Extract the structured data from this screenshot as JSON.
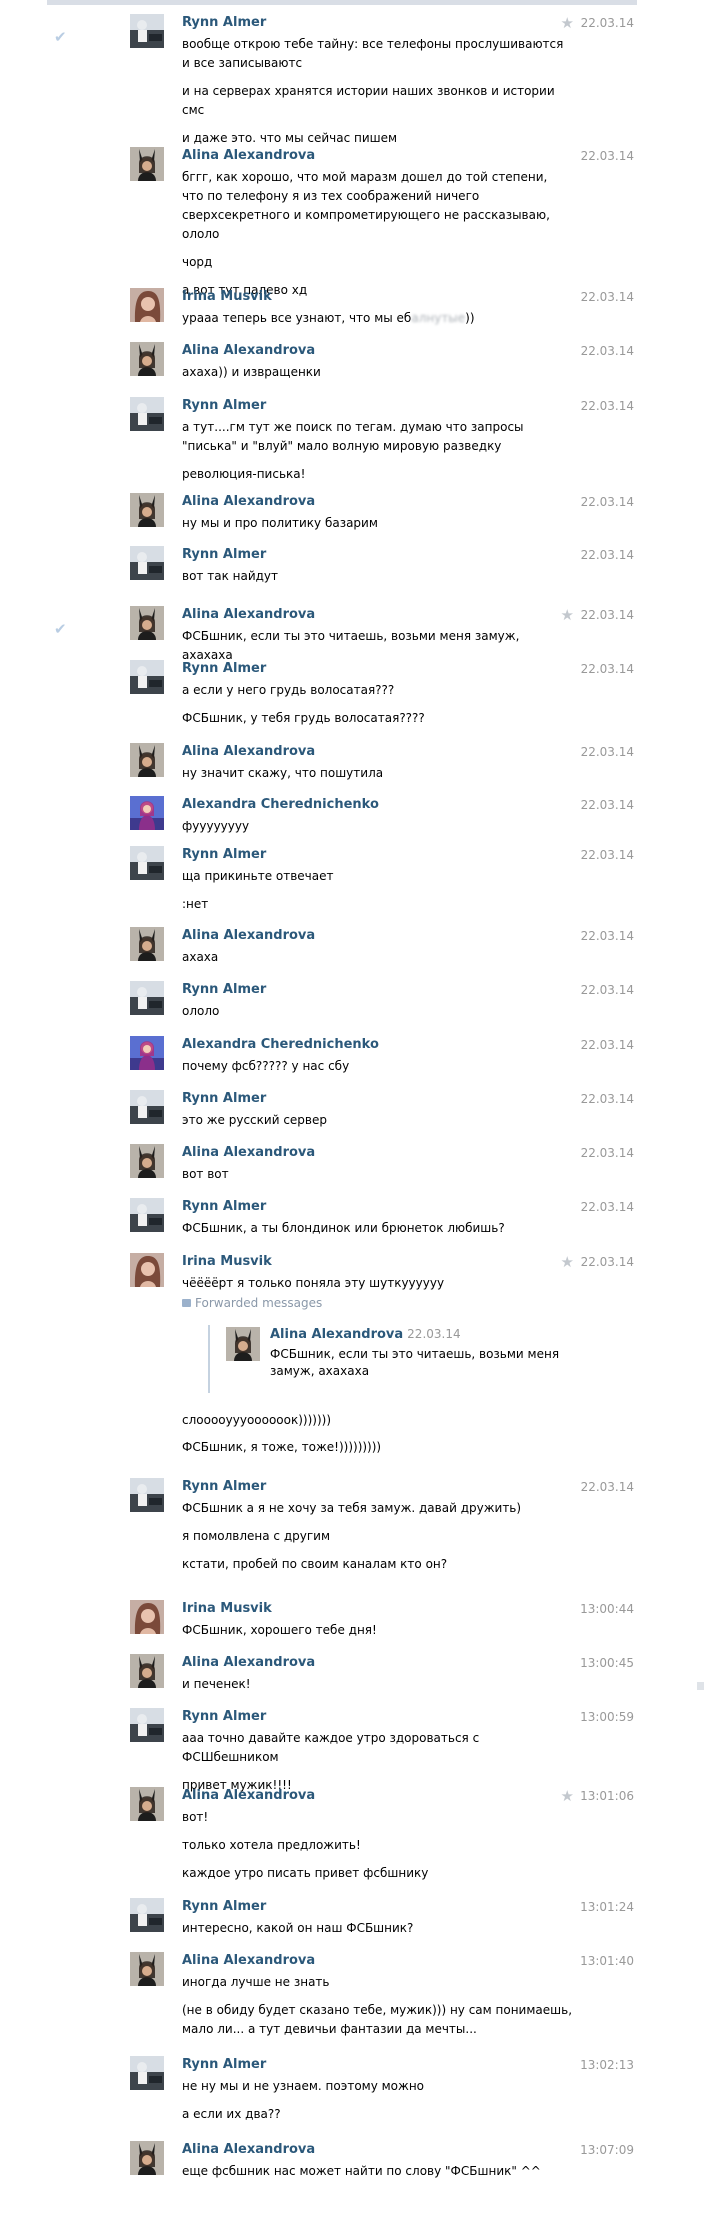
{
  "colors": {
    "name": "#2b587a",
    "time": "#999999",
    "text": "#000000"
  },
  "icons": {
    "star": "star-icon",
    "check": "checkmark-icon",
    "forward": "forwarded-icon"
  },
  "messages": [
    {
      "author": "Rynn Almer",
      "avatar": "rynn",
      "time": "22.03.14",
      "star": true,
      "check": true,
      "lines": [
        "вообще открою тебе тайну: все телефоны прослушиваются и все записываютс",
        "и на серверах хранятся истории наших звонков и истории смс",
        "и даже это. что мы сейчас пишем"
      ]
    },
    {
      "author": "Alina Alexandrova",
      "avatar": "alina",
      "time": "22.03.14",
      "lines": [
        "бггг, как хорошо, что мой маразм дошел до той степени, что по телефону я из тех соображений ничего сверхсекретного и компрометирующего не рассказываю, ололо",
        "чорд",
        "а вот тут палево хд"
      ]
    },
    {
      "author": "Irina Musvik",
      "avatar": "irina",
      "time": "22.03.14",
      "lines": [
        "урааа теперь все узнают, что мы еб",
        "))"
      ],
      "blur": "алнутые"
    },
    {
      "author": "Alina Alexandrova",
      "avatar": "alina",
      "time": "22.03.14",
      "lines": [
        "ахаха)) и извращенки"
      ]
    },
    {
      "author": "Rynn Almer",
      "avatar": "rynn",
      "time": "22.03.14",
      "lines": [
        "а тут....гм тут же поиск по тегам. думаю что запросы \"писька\" и \"влуй\" мало волную мировую разведку",
        "революция-писька!"
      ]
    },
    {
      "author": "Alina Alexandrova",
      "avatar": "alina",
      "time": "22.03.14",
      "lines": [
        "ну мы и про политику базарим"
      ]
    },
    {
      "author": "Rynn Almer",
      "avatar": "rynn",
      "time": "22.03.14",
      "lines": [
        "вот так найдут"
      ]
    },
    {
      "author": "Alina Alexandrova",
      "avatar": "alina",
      "time": "22.03.14",
      "star": true,
      "check": true,
      "lines": [
        "ФСБшник, если ты это читаешь, возьми меня замуж, ахахаха"
      ]
    },
    {
      "author": "Rynn Almer",
      "avatar": "rynn",
      "time": "22.03.14",
      "lines": [
        "а если у него грудь волосатая???",
        "ФСБшник, у тебя грудь волосатая????"
      ]
    },
    {
      "author": "Alina Alexandrova",
      "avatar": "alina",
      "time": "22.03.14",
      "lines": [
        "ну значит скажу, что пошутила"
      ]
    },
    {
      "author": "Alexandra Cherednichenko",
      "avatar": "alexandra",
      "time": "22.03.14",
      "lines": [
        "фуууууууу"
      ]
    },
    {
      "author": "Rynn Almer",
      "avatar": "rynn",
      "time": "22.03.14",
      "lines": [
        "ща прикиньте отвечает",
        ":нет"
      ]
    },
    {
      "author": "Alina Alexandrova",
      "avatar": "alina",
      "time": "22.03.14",
      "lines": [
        "ахаха"
      ]
    },
    {
      "author": "Rynn Almer",
      "avatar": "rynn",
      "time": "22.03.14",
      "lines": [
        "ололо"
      ]
    },
    {
      "author": "Alexandra Cherednichenko",
      "avatar": "alexandra",
      "time": "22.03.14",
      "lines": [
        "почему фсб????? у нас сбу"
      ]
    },
    {
      "author": "Rynn Almer",
      "avatar": "rynn",
      "time": "22.03.14",
      "lines": [
        "это же русский сервер"
      ]
    },
    {
      "author": "Alina Alexandrova",
      "avatar": "alina",
      "time": "22.03.14",
      "lines": [
        "вот вот"
      ]
    },
    {
      "author": "Rynn Almer",
      "avatar": "rynn",
      "time": "22.03.14",
      "lines": [
        "ФСБшник, а ты блондинок или брюнеток любишь?"
      ]
    },
    {
      "author": "Irina Musvik",
      "avatar": "irina",
      "time": "22.03.14",
      "star": true,
      "lines": [
        "чёёёёрт я только поняла эту шуткуууууу"
      ]
    },
    {
      "author": "Rynn Almer",
      "avatar": "rynn",
      "time": "22.03.14",
      "lines": [
        "ФСБшник а я не хочу за тебя замуж. давай дружить)",
        "я помолвлена с другим",
        "кстати, пробей по своим каналам кто он?"
      ]
    },
    {
      "author": "Irina Musvik",
      "avatar": "irina",
      "time": "13:00:44",
      "lines": [
        "ФСБшник, хорошего тебе дня!"
      ]
    },
    {
      "author": "Alina Alexandrova",
      "avatar": "alina",
      "time": "13:00:45",
      "lines": [
        "и печенек!"
      ]
    },
    {
      "author": "Rynn Almer",
      "avatar": "rynn",
      "time": "13:00:59",
      "lines": [
        "ааа точно давайте каждое утро здороваться с ФСШбешником",
        "привет мужик!!!!"
      ]
    },
    {
      "author": "Alina Alexandrova",
      "avatar": "alina",
      "time": "13:01:06",
      "star": true,
      "lines": [
        "вот!",
        "только хотела предложить!",
        "каждое утро писать привет фсбшнику"
      ]
    },
    {
      "author": "Rynn Almer",
      "avatar": "rynn",
      "time": "13:01:24",
      "lines": [
        "интересно, какой он наш ФСБшник?"
      ]
    },
    {
      "author": "Alina Alexandrova",
      "avatar": "alina",
      "time": "13:01:40",
      "lines": [
        "иногда лучше не знать",
        "(не в обиду будет сказано тебе, мужик))) ну сам понимаешь, мало ли... а тут девичьи фантазии да мечты..."
      ]
    },
    {
      "author": "Rynn Almer",
      "avatar": "rynn",
      "time": "13:02:13",
      "lines": [
        "не ну мы и не узнаем. поэтому можно",
        "а если их два??"
      ]
    },
    {
      "author": "Alina Alexandrova",
      "avatar": "alina",
      "time": "13:07:09",
      "lines": [
        "еще фсбшник нас может найти по слову \"ФСБшник\" ^^"
      ]
    }
  ],
  "forward": {
    "label": "Forwarded messages",
    "author": "Alina Alexandrova",
    "time": "22.03.14",
    "text": "ФСБшник, если ты это читаешь, возьми меня замуж, ахахаха",
    "after": [
      "слооооуууоооооок)))))))",
      "ФСБшник, я тоже, тоже!)))))))))"
    ]
  }
}
